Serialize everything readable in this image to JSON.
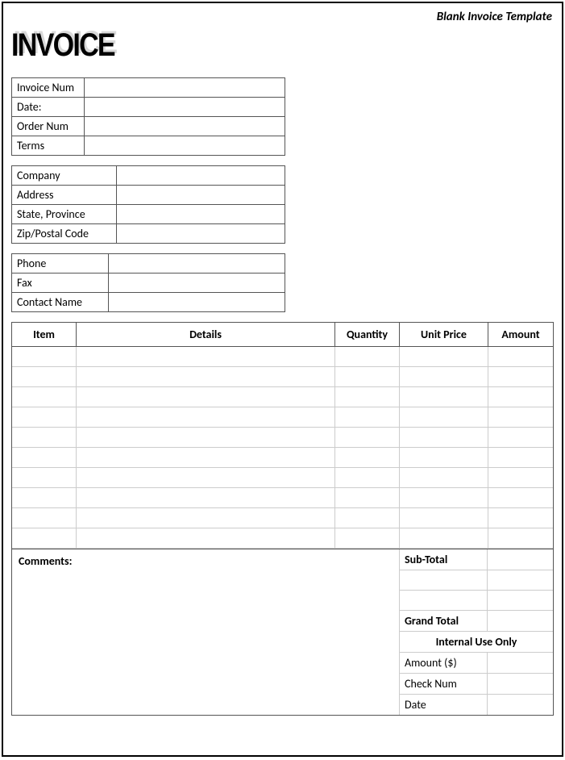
{
  "top_label": "Blank Invoice Template",
  "title": "INVOICE",
  "meta1": {
    "invoice_num_label": "Invoice Num",
    "invoice_num": "",
    "date_label": "Date:",
    "date": "",
    "order_num_label": "Order Num",
    "order_num": "",
    "terms_label": "Terms",
    "terms": ""
  },
  "meta2": {
    "company_label": "Company",
    "company": "",
    "address_label": "Address",
    "address": "",
    "state_label": "State, Province",
    "state": "",
    "zip_label": "Zip/Postal Code",
    "zip": ""
  },
  "meta3": {
    "phone_label": "Phone",
    "phone": "",
    "fax_label": "Fax",
    "fax": "",
    "contact_label": "Contact Name",
    "contact": ""
  },
  "table": {
    "headers": {
      "item": "Item",
      "details": "Details",
      "quantity": "Quantity",
      "unit_price": "Unit Price",
      "amount": "Amount"
    },
    "rows": [
      {
        "item": "",
        "details": "",
        "quantity": "",
        "unit_price": "",
        "amount": ""
      },
      {
        "item": "",
        "details": "",
        "quantity": "",
        "unit_price": "",
        "amount": ""
      },
      {
        "item": "",
        "details": "",
        "quantity": "",
        "unit_price": "",
        "amount": ""
      },
      {
        "item": "",
        "details": "",
        "quantity": "",
        "unit_price": "",
        "amount": ""
      },
      {
        "item": "",
        "details": "",
        "quantity": "",
        "unit_price": "",
        "amount": ""
      },
      {
        "item": "",
        "details": "",
        "quantity": "",
        "unit_price": "",
        "amount": ""
      },
      {
        "item": "",
        "details": "",
        "quantity": "",
        "unit_price": "",
        "amount": ""
      },
      {
        "item": "",
        "details": "",
        "quantity": "",
        "unit_price": "",
        "amount": ""
      },
      {
        "item": "",
        "details": "",
        "quantity": "",
        "unit_price": "",
        "amount": ""
      },
      {
        "item": "",
        "details": "",
        "quantity": "",
        "unit_price": "",
        "amount": ""
      }
    ]
  },
  "comments_label": "Comments:",
  "totals": {
    "subtotal_label": "Sub-Total",
    "subtotal": "",
    "blank1_label": "",
    "blank1": "",
    "blank2_label": "",
    "blank2": "",
    "grand_total_label": "Grand Total",
    "grand_total": "",
    "internal_header": "Internal Use Only",
    "amount_label": "Amount ($)",
    "amount": "",
    "check_label": "Check Num",
    "check": "",
    "date_label": "Date",
    "date": ""
  }
}
